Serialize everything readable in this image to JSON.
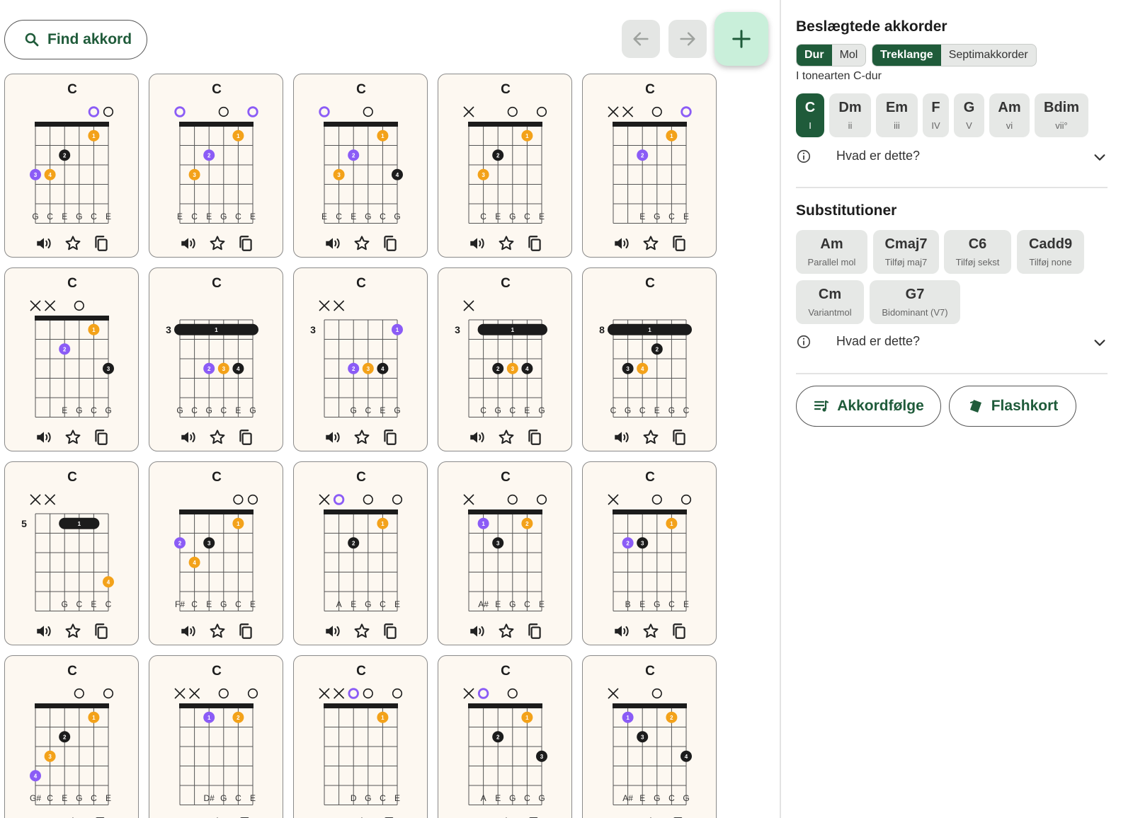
{
  "search": {
    "label": "Find akkord"
  },
  "card_actions": [
    "speaker-icon",
    "star-icon",
    "copy-icon"
  ],
  "cards": [
    {
      "name": "C",
      "marks": [
        "",
        "",
        "",
        "",
        "o",
        "o"
      ],
      "fret_label": "",
      "open_colored": [
        false,
        false,
        false,
        false,
        true,
        false
      ],
      "nut": true,
      "dots": [
        {
          "s": 0,
          "f": 3,
          "n": "3",
          "c": "purple"
        },
        {
          "s": 1,
          "f": 3,
          "n": "4",
          "c": "orange"
        },
        {
          "s": 2,
          "f": 2,
          "n": "2",
          "c": "black"
        },
        {
          "s": 4,
          "f": 1,
          "n": "1",
          "c": "orange"
        }
      ],
      "bars": [],
      "notes": [
        "G",
        "C",
        "E",
        "G",
        "C",
        "E"
      ]
    },
    {
      "name": "C",
      "marks": [
        "o",
        "",
        "",
        "o",
        "",
        "o"
      ],
      "fret_label": "",
      "open_colored": [
        true,
        false,
        false,
        false,
        false,
        true
      ],
      "nut": true,
      "dots": [
        {
          "s": 1,
          "f": 3,
          "n": "3",
          "c": "orange"
        },
        {
          "s": 2,
          "f": 2,
          "n": "2",
          "c": "purple"
        },
        {
          "s": 4,
          "f": 1,
          "n": "1",
          "c": "orange"
        }
      ],
      "bars": [],
      "notes": [
        "E",
        "C",
        "E",
        "G",
        "C",
        "E"
      ]
    },
    {
      "name": "C",
      "marks": [
        "o",
        "",
        "",
        "o",
        "",
        ""
      ],
      "fret_label": "",
      "open_colored": [
        true,
        false,
        false,
        false,
        false,
        false
      ],
      "nut": true,
      "dots": [
        {
          "s": 1,
          "f": 3,
          "n": "3",
          "c": "orange"
        },
        {
          "s": 2,
          "f": 2,
          "n": "2",
          "c": "purple"
        },
        {
          "s": 4,
          "f": 1,
          "n": "1",
          "c": "orange"
        },
        {
          "s": 5,
          "f": 3,
          "n": "4",
          "c": "black"
        }
      ],
      "bars": [],
      "notes": [
        "E",
        "C",
        "E",
        "G",
        "C",
        "G"
      ]
    },
    {
      "name": "C",
      "marks": [
        "x",
        "",
        "",
        "o",
        "",
        "o"
      ],
      "fret_label": "",
      "open_colored": [
        false,
        false,
        false,
        false,
        false,
        false
      ],
      "nut": true,
      "dots": [
        {
          "s": 1,
          "f": 3,
          "n": "3",
          "c": "orange"
        },
        {
          "s": 2,
          "f": 2,
          "n": "2",
          "c": "black"
        },
        {
          "s": 4,
          "f": 1,
          "n": "1",
          "c": "orange"
        }
      ],
      "bars": [],
      "notes": [
        "",
        "C",
        "E",
        "G",
        "C",
        "E"
      ]
    },
    {
      "name": "C",
      "marks": [
        "x",
        "x",
        "",
        "o",
        "",
        "o"
      ],
      "fret_label": "",
      "open_colored": [
        false,
        false,
        false,
        false,
        false,
        true
      ],
      "nut": true,
      "dots": [
        {
          "s": 2,
          "f": 2,
          "n": "2",
          "c": "purple"
        },
        {
          "s": 4,
          "f": 1,
          "n": "1",
          "c": "orange"
        }
      ],
      "bars": [],
      "notes": [
        "",
        "",
        "E",
        "G",
        "C",
        "E"
      ]
    },
    {
      "name": "C",
      "marks": [
        "x",
        "x",
        "",
        "o",
        "",
        ""
      ],
      "fret_label": "",
      "open_colored": [
        false,
        false,
        false,
        false,
        false,
        false
      ],
      "nut": true,
      "dots": [
        {
          "s": 2,
          "f": 2,
          "n": "2",
          "c": "purple"
        },
        {
          "s": 4,
          "f": 1,
          "n": "1",
          "c": "orange"
        },
        {
          "s": 5,
          "f": 3,
          "n": "3",
          "c": "black"
        }
      ],
      "bars": [],
      "notes": [
        "",
        "",
        "E",
        "G",
        "C",
        "G"
      ]
    },
    {
      "name": "C",
      "marks": [
        "",
        "",
        "",
        "",
        "",
        ""
      ],
      "fret_label": "3",
      "open_colored": [
        false,
        false,
        false,
        false,
        false,
        false
      ],
      "nut": false,
      "dots": [
        {
          "s": 2,
          "f": 3,
          "n": "2",
          "c": "purple"
        },
        {
          "s": 3,
          "f": 3,
          "n": "3",
          "c": "orange"
        },
        {
          "s": 4,
          "f": 3,
          "n": "4",
          "c": "black"
        }
      ],
      "bars": [
        {
          "from": 0,
          "to": 5,
          "f": 1,
          "n": "1"
        }
      ],
      "notes": [
        "G",
        "C",
        "G",
        "C",
        "E",
        "G"
      ]
    },
    {
      "name": "C",
      "marks": [
        "x",
        "x",
        "",
        "",
        "",
        ""
      ],
      "fret_label": "3",
      "open_colored": [
        false,
        false,
        false,
        false,
        false,
        false
      ],
      "nut": false,
      "dots": [
        {
          "s": 2,
          "f": 3,
          "n": "2",
          "c": "purple"
        },
        {
          "s": 3,
          "f": 3,
          "n": "3",
          "c": "orange"
        },
        {
          "s": 4,
          "f": 3,
          "n": "4",
          "c": "black"
        },
        {
          "s": 5,
          "f": 1,
          "n": "1",
          "c": "purple"
        }
      ],
      "bars": [],
      "notes": [
        "",
        "",
        "G",
        "C",
        "E",
        "G"
      ]
    },
    {
      "name": "C",
      "marks": [
        "x",
        "",
        "",
        "",
        "",
        ""
      ],
      "fret_label": "3",
      "open_colored": [
        false,
        false,
        false,
        false,
        false,
        false
      ],
      "nut": false,
      "dots": [
        {
          "s": 2,
          "f": 3,
          "n": "2",
          "c": "black"
        },
        {
          "s": 3,
          "f": 3,
          "n": "3",
          "c": "orange"
        },
        {
          "s": 4,
          "f": 3,
          "n": "4",
          "c": "black"
        }
      ],
      "bars": [
        {
          "from": 1,
          "to": 5,
          "f": 1,
          "n": "1"
        }
      ],
      "notes": [
        "",
        "C",
        "G",
        "C",
        "E",
        "G"
      ]
    },
    {
      "name": "C",
      "marks": [
        "",
        "",
        "",
        "",
        "",
        ""
      ],
      "fret_label": "8",
      "open_colored": [
        false,
        false,
        false,
        false,
        false,
        false
      ],
      "nut": false,
      "dots": [
        {
          "s": 1,
          "f": 3,
          "n": "3",
          "c": "black"
        },
        {
          "s": 2,
          "f": 3,
          "n": "4",
          "c": "orange"
        },
        {
          "s": 3,
          "f": 2,
          "n": "2",
          "c": "black"
        }
      ],
      "bars": [
        {
          "from": 0,
          "to": 5,
          "f": 1,
          "n": "1"
        }
      ],
      "notes": [
        "C",
        "G",
        "C",
        "E",
        "G",
        "C"
      ]
    },
    {
      "name": "C",
      "marks": [
        "x",
        "x",
        "",
        "",
        "",
        ""
      ],
      "fret_label": "5",
      "open_colored": [
        false,
        false,
        false,
        false,
        false,
        false
      ],
      "nut": false,
      "dots": [
        {
          "s": 5,
          "f": 4,
          "n": "4",
          "c": "orange"
        }
      ],
      "bars": [
        {
          "from": 2,
          "to": 4,
          "f": 1,
          "n": "1"
        }
      ],
      "notes": [
        "",
        "",
        "G",
        "C",
        "E",
        "C"
      ]
    },
    {
      "name": "C",
      "marks": [
        "",
        "",
        "",
        "",
        "o",
        "o"
      ],
      "fret_label": "",
      "open_colored": [
        false,
        false,
        false,
        false,
        false,
        false
      ],
      "nut": true,
      "dots": [
        {
          "s": 0,
          "f": 2,
          "n": "2",
          "c": "purple"
        },
        {
          "s": 1,
          "f": 3,
          "n": "4",
          "c": "orange"
        },
        {
          "s": 2,
          "f": 2,
          "n": "3",
          "c": "black"
        },
        {
          "s": 4,
          "f": 1,
          "n": "1",
          "c": "orange"
        }
      ],
      "bars": [],
      "notes": [
        "F#",
        "C",
        "E",
        "G",
        "C",
        "E"
      ]
    },
    {
      "name": "C",
      "marks": [
        "x",
        "o",
        "",
        "o",
        "",
        "o"
      ],
      "fret_label": "",
      "open_colored": [
        false,
        true,
        false,
        false,
        false,
        false
      ],
      "nut": true,
      "dots": [
        {
          "s": 2,
          "f": 2,
          "n": "2",
          "c": "black"
        },
        {
          "s": 4,
          "f": 1,
          "n": "1",
          "c": "orange"
        }
      ],
      "bars": [],
      "notes": [
        "",
        "A",
        "E",
        "G",
        "C",
        "E"
      ]
    },
    {
      "name": "C",
      "marks": [
        "x",
        "",
        "",
        "o",
        "",
        "o"
      ],
      "fret_label": "",
      "open_colored": [
        false,
        false,
        false,
        false,
        false,
        false
      ],
      "nut": true,
      "dots": [
        {
          "s": 1,
          "f": 1,
          "n": "1",
          "c": "purple"
        },
        {
          "s": 2,
          "f": 2,
          "n": "3",
          "c": "black"
        },
        {
          "s": 4,
          "f": 1,
          "n": "2",
          "c": "orange"
        }
      ],
      "bars": [],
      "notes": [
        "",
        "A#",
        "E",
        "G",
        "C",
        "E"
      ]
    },
    {
      "name": "C",
      "marks": [
        "x",
        "",
        "",
        "o",
        "",
        "o"
      ],
      "fret_label": "",
      "open_colored": [
        false,
        false,
        false,
        false,
        false,
        false
      ],
      "nut": true,
      "dots": [
        {
          "s": 1,
          "f": 2,
          "n": "2",
          "c": "purple"
        },
        {
          "s": 2,
          "f": 2,
          "n": "3",
          "c": "black"
        },
        {
          "s": 4,
          "f": 1,
          "n": "1",
          "c": "orange"
        }
      ],
      "bars": [],
      "notes": [
        "",
        "B",
        "E",
        "G",
        "C",
        "E"
      ]
    },
    {
      "name": "C",
      "marks": [
        "",
        "",
        "",
        "o",
        "",
        "o"
      ],
      "fret_label": "",
      "open_colored": [
        false,
        false,
        false,
        false,
        false,
        false
      ],
      "nut": true,
      "dots": [
        {
          "s": 0,
          "f": 4,
          "n": "4",
          "c": "purple"
        },
        {
          "s": 1,
          "f": 3,
          "n": "3",
          "c": "orange"
        },
        {
          "s": 2,
          "f": 2,
          "n": "2",
          "c": "black"
        },
        {
          "s": 4,
          "f": 1,
          "n": "1",
          "c": "orange"
        }
      ],
      "bars": [],
      "notes": [
        "G#",
        "C",
        "E",
        "G",
        "C",
        "E"
      ]
    },
    {
      "name": "C",
      "marks": [
        "x",
        "x",
        "",
        "o",
        "",
        "o"
      ],
      "fret_label": "",
      "open_colored": [
        false,
        false,
        false,
        false,
        false,
        false
      ],
      "nut": true,
      "dots": [
        {
          "s": 2,
          "f": 1,
          "n": "1",
          "c": "purple"
        },
        {
          "s": 4,
          "f": 1,
          "n": "2",
          "c": "orange"
        }
      ],
      "bars": [],
      "notes": [
        "",
        "",
        "D#",
        "G",
        "C",
        "E"
      ]
    },
    {
      "name": "C",
      "marks": [
        "x",
        "x",
        "o",
        "o",
        "",
        "o"
      ],
      "fret_label": "",
      "open_colored": [
        false,
        false,
        true,
        false,
        false,
        false
      ],
      "nut": true,
      "dots": [
        {
          "s": 4,
          "f": 1,
          "n": "1",
          "c": "orange"
        }
      ],
      "bars": [],
      "notes": [
        "",
        "",
        "D",
        "G",
        "C",
        "E"
      ]
    },
    {
      "name": "C",
      "marks": [
        "x",
        "o",
        "",
        "o",
        "",
        ""
      ],
      "fret_label": "",
      "open_colored": [
        false,
        true,
        false,
        false,
        false,
        false
      ],
      "nut": true,
      "dots": [
        {
          "s": 2,
          "f": 2,
          "n": "2",
          "c": "black"
        },
        {
          "s": 4,
          "f": 1,
          "n": "1",
          "c": "orange"
        },
        {
          "s": 5,
          "f": 3,
          "n": "3",
          "c": "black"
        }
      ],
      "bars": [],
      "notes": [
        "",
        "A",
        "E",
        "G",
        "C",
        "G"
      ]
    },
    {
      "name": "C",
      "marks": [
        "x",
        "",
        "",
        "o",
        "",
        ""
      ],
      "fret_label": "",
      "open_colored": [
        false,
        false,
        false,
        false,
        false,
        false
      ],
      "nut": true,
      "dots": [
        {
          "s": 1,
          "f": 1,
          "n": "1",
          "c": "purple"
        },
        {
          "s": 2,
          "f": 2,
          "n": "3",
          "c": "black"
        },
        {
          "s": 4,
          "f": 1,
          "n": "2",
          "c": "orange"
        },
        {
          "s": 5,
          "f": 3,
          "n": "4",
          "c": "black"
        }
      ],
      "bars": [],
      "notes": [
        "",
        "A#",
        "E",
        "G",
        "C",
        "G"
      ]
    }
  ],
  "panel": {
    "related_title": "Beslægtede akkorder",
    "mode_options": [
      {
        "label": "Dur",
        "active": true
      },
      {
        "label": "Mol",
        "active": false
      }
    ],
    "type_options": [
      {
        "label": "Treklange",
        "active": true
      },
      {
        "label": "Septimakkorder",
        "active": false
      }
    ],
    "key_note": "I tonearten C-dur",
    "degrees": [
      {
        "chord": "C",
        "degree": "I",
        "active": true
      },
      {
        "chord": "Dm",
        "degree": "ii",
        "active": false
      },
      {
        "chord": "Em",
        "degree": "iii",
        "active": false
      },
      {
        "chord": "F",
        "degree": "IV",
        "active": false
      },
      {
        "chord": "G",
        "degree": "V",
        "active": false
      },
      {
        "chord": "Am",
        "degree": "vi",
        "active": false
      },
      {
        "chord": "Bdim",
        "degree": "vii°",
        "active": false
      }
    ],
    "info_label": "Hvad er dette?",
    "subs_title": "Substitutioner",
    "subs": [
      {
        "chord": "Am",
        "desc": "Parallel mol"
      },
      {
        "chord": "Cmaj7",
        "desc": "Tilføj maj7"
      },
      {
        "chord": "C6",
        "desc": "Tilføj sekst"
      },
      {
        "chord": "Cadd9",
        "desc": "Tilføj none"
      },
      {
        "chord": "Cm",
        "desc": "Variantmol"
      },
      {
        "chord": "G7",
        "desc": "Bidominant (V7)"
      }
    ],
    "progression_label": "Akkordfølge",
    "flashcards_label": "Flashkort"
  },
  "colors": {
    "accent": "#1f5b3a",
    "purple": "#8b5cf6",
    "orange": "#f3a21a",
    "black": "#1c1c1c",
    "fab": "#c9efda"
  }
}
